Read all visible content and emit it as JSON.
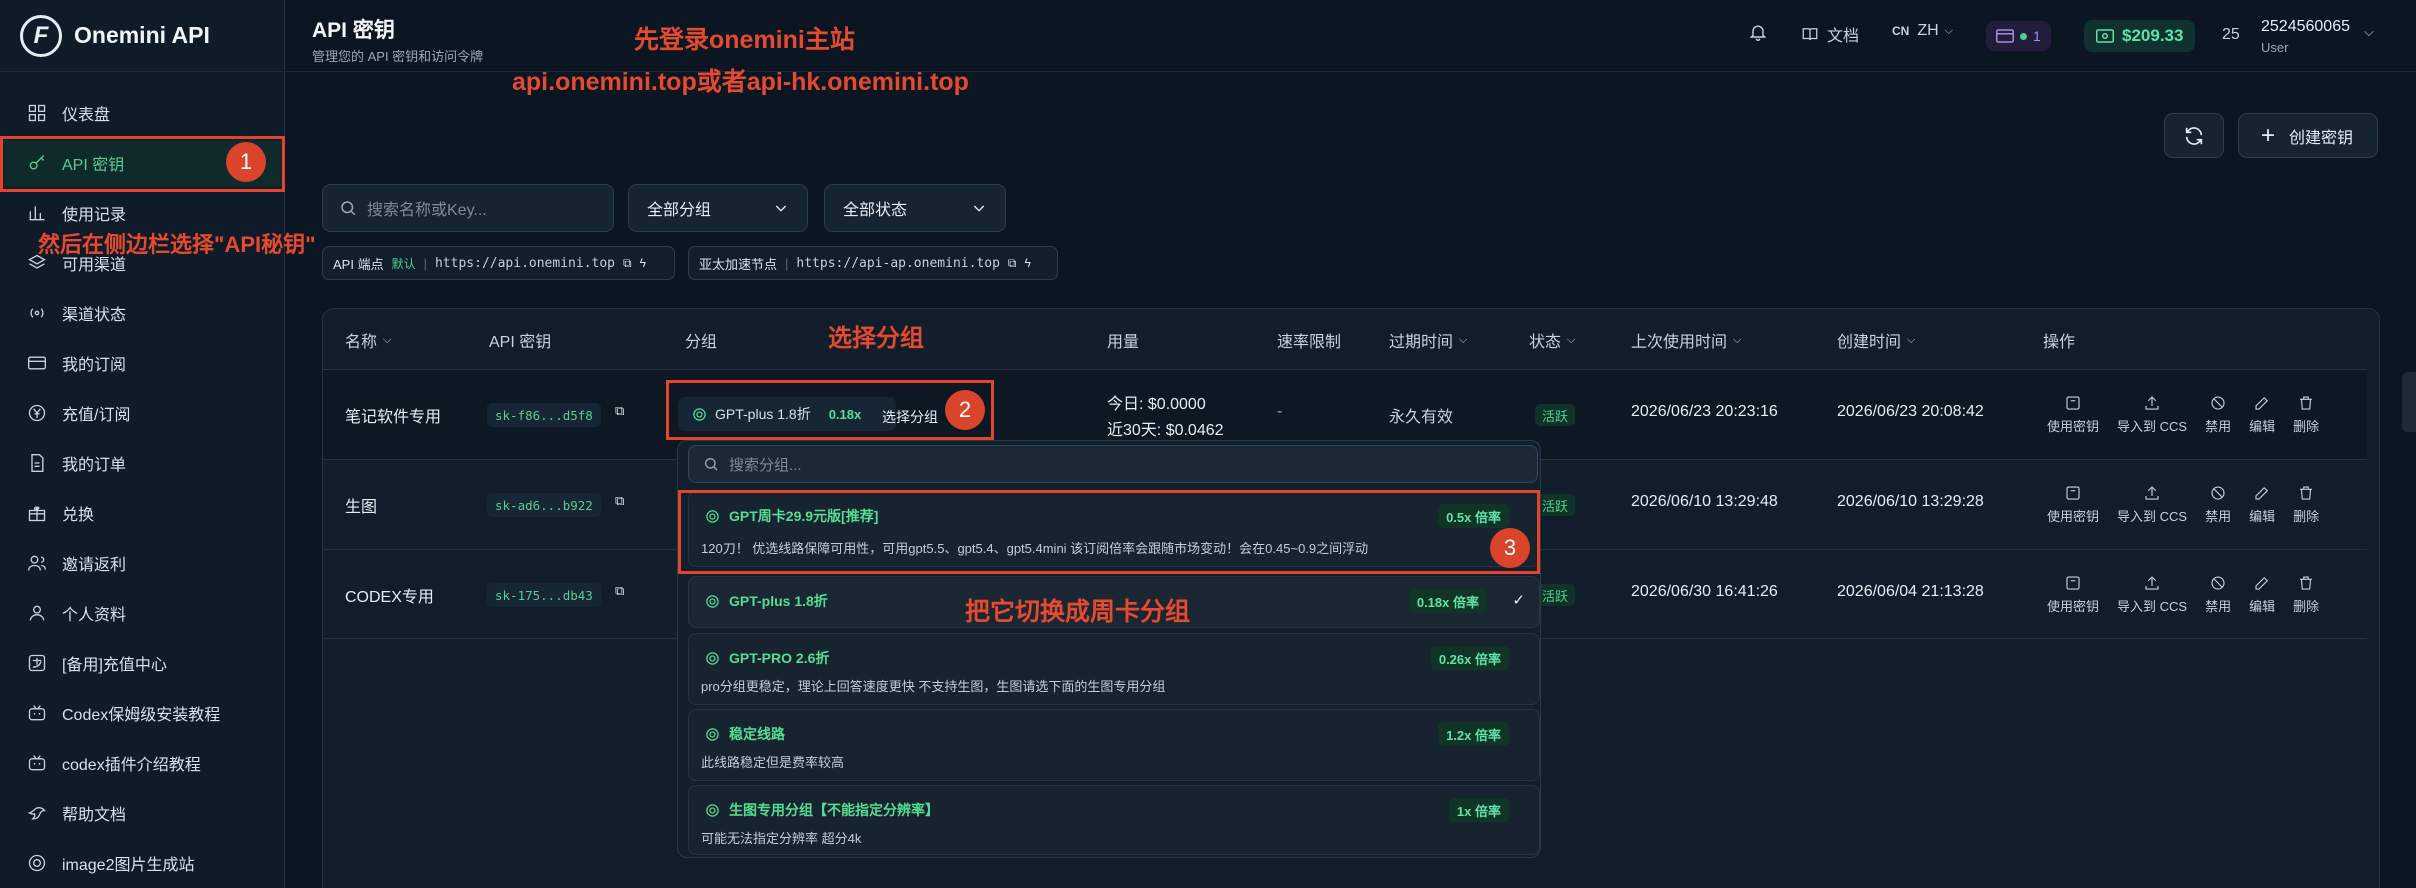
{
  "brand": {
    "logo_letter": "F",
    "name": "Onemini API"
  },
  "sidebar": {
    "items": [
      {
        "label": "仪表盘",
        "icon": "dashboard-icon"
      },
      {
        "label": "API 密钥",
        "icon": "key-icon",
        "active": true
      },
      {
        "label": "使用记录",
        "icon": "bar-chart-icon"
      },
      {
        "label": "可用渠道",
        "icon": "layers-icon"
      },
      {
        "label": "渠道状态",
        "icon": "signal-icon"
      },
      {
        "label": "我的订阅",
        "icon": "card-icon"
      },
      {
        "label": "充值/订阅",
        "icon": "yen-icon"
      },
      {
        "label": "我的订单",
        "icon": "document-icon"
      },
      {
        "label": "兑换",
        "icon": "gift-icon"
      },
      {
        "label": "邀请返利",
        "icon": "users-icon"
      },
      {
        "label": "个人资料",
        "icon": "user-icon"
      },
      {
        "label": "[备用]充值中心",
        "icon": "alipay-icon"
      },
      {
        "label": "Codex保姆级安装教程",
        "icon": "bilibili-icon"
      },
      {
        "label": "codex插件介绍教程",
        "icon": "bilibili-icon"
      },
      {
        "label": "帮助文档",
        "icon": "bird-icon"
      },
      {
        "label": "image2图片生成站",
        "icon": "openai-icon"
      }
    ]
  },
  "header": {
    "title": "API 密钥",
    "subtitle": "管理您的 API 密钥和访问令牌",
    "docs_label": "文档",
    "lang_code": "CN",
    "lang_label": "ZH",
    "keys_count": "1",
    "balance": "$209.33",
    "user_count": "25",
    "user_id": "2524560065",
    "user_role": "User"
  },
  "toolbar": {
    "create_label": "创建密钥",
    "search_placeholder": "搜索名称或Key...",
    "group_filter": "全部分组",
    "status_filter": "全部状态"
  },
  "endpoints": [
    {
      "label": "API 端点",
      "tag": "默认",
      "url": "https://api.onemini.top"
    },
    {
      "label": "亚太加速节点",
      "tag": "",
      "url": "https://api-ap.onemini.top"
    }
  ],
  "table": {
    "columns": [
      "名称",
      "API 密钥",
      "分组",
      "用量",
      "速率限制",
      "过期时间",
      "状态",
      "上次使用时间",
      "创建时间",
      "操作"
    ],
    "rows": [
      {
        "name": "笔记软件专用",
        "key": "sk-f86...d5f8",
        "group": "GPT-plus 1.8折",
        "mult": "0.18x",
        "choose": "选择分组",
        "usage_today": "今日: $0.0000",
        "usage_30": "近30天: $0.0462",
        "rate": "-",
        "expiry": "永久有效",
        "status": "活跃",
        "last_used": "2026/06/23 20:23:16",
        "created": "2026/06/23 20:08:42"
      },
      {
        "name": "生图",
        "key": "sk-ad6...b922",
        "status": "活跃",
        "last_used": "2026/06/10 13:29:48",
        "created": "2026/06/10 13:29:28"
      },
      {
        "name": "CODEX专用",
        "key": "sk-175...db43",
        "status": "活跃",
        "last_used": "2026/06/30 16:41:26",
        "created": "2026/06/04 21:13:28"
      }
    ],
    "ops": [
      "使用密钥",
      "导入到 CCS",
      "禁用",
      "编辑",
      "删除"
    ]
  },
  "dropdown": {
    "search_placeholder": "搜索分组...",
    "options": [
      {
        "name": "GPT周卡29.9元版[推荐]",
        "mult": "0.5x 倍率",
        "desc": "120刀！ 优选线路保障可用性，可用gpt5.5、gpt5.4、gpt5.4mini 该订阅倍率会跟随市场变动！会在0.45~0.9之间浮动"
      },
      {
        "name": "GPT-plus 1.8折",
        "mult": "0.18x 倍率",
        "desc": "",
        "selected": true
      },
      {
        "name": "GPT-PRO 2.6折",
        "mult": "0.26x 倍率",
        "desc": "pro分组更稳定，理论上回答速度更快 不支持生图，生图请选下面的生图专用分组"
      },
      {
        "name": "稳定线路",
        "mult": "1.2x 倍率",
        "desc": "此线路稳定但是费率较高"
      },
      {
        "name": "生图专用分组【不能指定分辨率】",
        "mult": "1x 倍率",
        "desc": "可能无法指定分辨率 超分4k"
      }
    ]
  },
  "annotations": {
    "login_title": "先登录onemini主站",
    "login_urls": "api.onemini.top或者api-hk.onemini.top",
    "sidebar_tip": "然后在侧边栏选择\"API秘钥\"",
    "select_group": "选择分组",
    "switch_tip": "把它切换成周卡分组",
    "badge1": "1",
    "badge2": "2",
    "badge3": "3"
  },
  "colors": {
    "accent_green": "#5ccc8f",
    "annotation_red": "#e2452c",
    "balance_green": "#5ee3a7"
  }
}
